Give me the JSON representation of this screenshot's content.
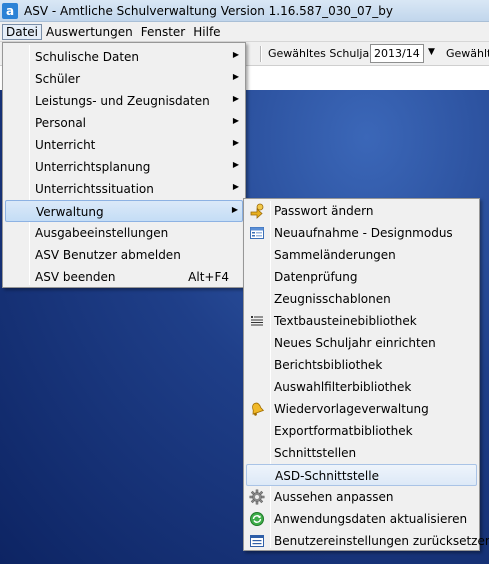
{
  "window": {
    "icon_letter": "a",
    "title": "ASV - Amtliche Schulverwaltung Version 1.16.587_030_07_by"
  },
  "menubar": [
    "Datei",
    "Auswertungen",
    "Fenster",
    "Hilfe"
  ],
  "toolbar": {
    "schuljahr_label": "Gewähltes Schuljahr",
    "schuljahr_value": "2013/14",
    "second_label": "Gewählte"
  },
  "main_menu": {
    "items": [
      {
        "label": "Schulische Daten",
        "arrow": "▶"
      },
      {
        "label": "Schüler",
        "arrow": "▶"
      },
      {
        "label": "Leistungs- und Zeugnisdaten",
        "arrow": "▶"
      },
      {
        "label": "Personal",
        "arrow": "▶"
      },
      {
        "label": "Unterricht",
        "arrow": "▶"
      },
      {
        "label": "Unterrichtsplanung",
        "arrow": "▶"
      },
      {
        "label": "Unterrichtssituation",
        "arrow": "▶"
      },
      {
        "label": "Verwaltung",
        "arrow": "▶"
      },
      {
        "label": "Ausgabeeinstellungen"
      },
      {
        "label": "ASV Benutzer abmelden"
      },
      {
        "label": "ASV beenden",
        "shortcut": "Alt+F4"
      }
    ],
    "active_item": "Verwaltung"
  },
  "sub_menu": {
    "items": [
      {
        "label": "Passwort ändern",
        "icon": "key-arrow-icon"
      },
      {
        "label": "Neuaufnahme - Designmodus",
        "icon": "form-window-icon"
      },
      {
        "label": "Sammeländerungen"
      },
      {
        "label": "Datenprüfung"
      },
      {
        "label": "Zeugnisschablonen"
      },
      {
        "label": "Textbausteinebibliothek",
        "icon": "text-block-icon"
      },
      {
        "label": "Neues Schuljahr einrichten"
      },
      {
        "label": "Berichtsbibliothek"
      },
      {
        "label": "Auswahlfilterbibliothek"
      },
      {
        "label": "Wiedervorlageverwaltung",
        "icon": "bell-icon"
      },
      {
        "label": "Exportformatbibliothek"
      },
      {
        "label": "Schnittstellen"
      },
      {
        "label": "ASD-Schnittstelle"
      },
      {
        "label": "Aussehen anpassen",
        "icon": "gear-icon"
      },
      {
        "label": "Anwendungsdaten aktualisieren",
        "icon": "refresh-globe-icon"
      },
      {
        "label": "Benutzereinstellungen zurücksetzen",
        "icon": "user-settings-icon"
      }
    ],
    "highlighted_item": "ASD-Schnittstelle"
  },
  "colors": {
    "menu_bg": "#f0f0f0",
    "highlight": "#c4ddf6",
    "desktop": "#1d3f86"
  }
}
